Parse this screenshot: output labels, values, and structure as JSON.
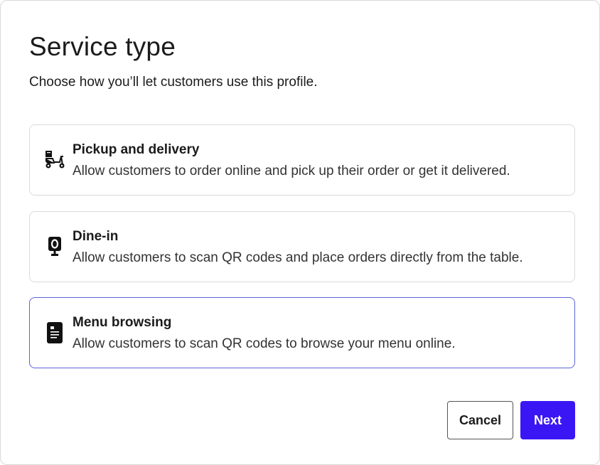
{
  "dialog": {
    "title": "Service type",
    "subtitle": "Choose how you’ll let customers use this profile."
  },
  "options": [
    {
      "title": "Pickup and delivery",
      "description": "Allow customers to order online and pick up their order or get it delivered.",
      "icon": "scooter-delivery-icon",
      "selected": false
    },
    {
      "title": "Dine-in",
      "description": "Allow customers to scan QR codes and place orders directly from the table.",
      "icon": "table-stand-icon",
      "selected": false
    },
    {
      "title": "Menu browsing",
      "description": "Allow customers to scan QR codes to browse your menu online.",
      "icon": "menu-document-icon",
      "selected": true
    }
  ],
  "buttons": {
    "cancel_label": "Cancel",
    "next_label": "Next"
  },
  "colors": {
    "accent": "#3a16f5",
    "selected_border": "#5b64d8"
  }
}
